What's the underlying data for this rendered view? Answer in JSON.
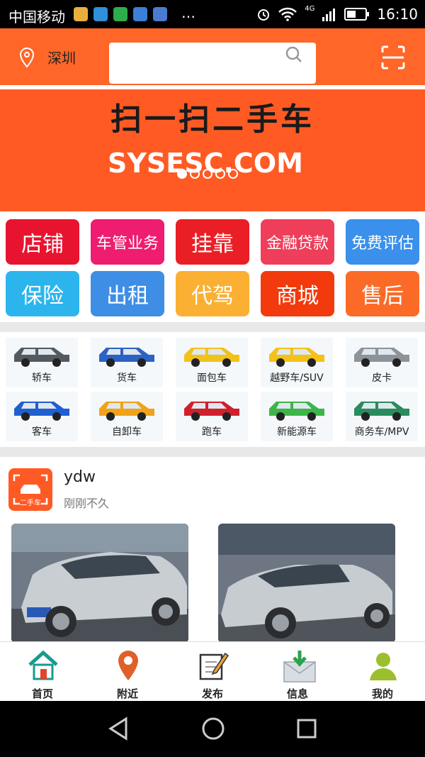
{
  "status": {
    "carrier": "中国移动",
    "time": "16:10",
    "network": "4G",
    "more": "…"
  },
  "header": {
    "city": "深圳",
    "search_placeholder": ""
  },
  "banner": {
    "title": "扫一扫二手车",
    "site": "SYSESC.COM",
    "active_slide": 1,
    "slide_count": 5
  },
  "quick_menu": [
    {
      "label": "店铺",
      "color": "#e8142f"
    },
    {
      "label": "车管业务",
      "color": "#ee1d6f"
    },
    {
      "label": "挂靠",
      "color": "#ea1f26"
    },
    {
      "label": "金融贷款",
      "color": "#ef3e5a"
    },
    {
      "label": "免费评估",
      "color": "#3a90ea"
    },
    {
      "label": "保险",
      "color": "#2cb5ed"
    },
    {
      "label": "出租",
      "color": "#3e8ee6"
    },
    {
      "label": "代驾",
      "color": "#fbb033"
    },
    {
      "label": "商城",
      "color": "#f23a0c"
    },
    {
      "label": "售后",
      "color": "#fb6b27"
    }
  ],
  "categories": [
    {
      "label": "轿车",
      "icon": "sedan-icon"
    },
    {
      "label": "货车",
      "icon": "truck-icon"
    },
    {
      "label": "面包车",
      "icon": "van-icon"
    },
    {
      "label": "越野车/SUV",
      "icon": "suv-icon"
    },
    {
      "label": "皮卡",
      "icon": "pickup-icon"
    },
    {
      "label": "客车",
      "icon": "bus-icon"
    },
    {
      "label": "自卸车",
      "icon": "dump-truck-icon"
    },
    {
      "label": "跑车",
      "icon": "sports-car-icon"
    },
    {
      "label": "新能源车",
      "icon": "ev-car-icon"
    },
    {
      "label": "商务车/MPV",
      "icon": "mpv-icon"
    }
  ],
  "post": {
    "username": "ydw",
    "time": "刚刚不久",
    "avatar_text": "二手车"
  },
  "tabbar": [
    {
      "label": "首页",
      "icon": "home-icon"
    },
    {
      "label": "附近",
      "icon": "location-icon"
    },
    {
      "label": "发布",
      "icon": "edit-icon"
    },
    {
      "label": "信息",
      "icon": "message-icon"
    },
    {
      "label": "我的",
      "icon": "user-icon"
    }
  ]
}
